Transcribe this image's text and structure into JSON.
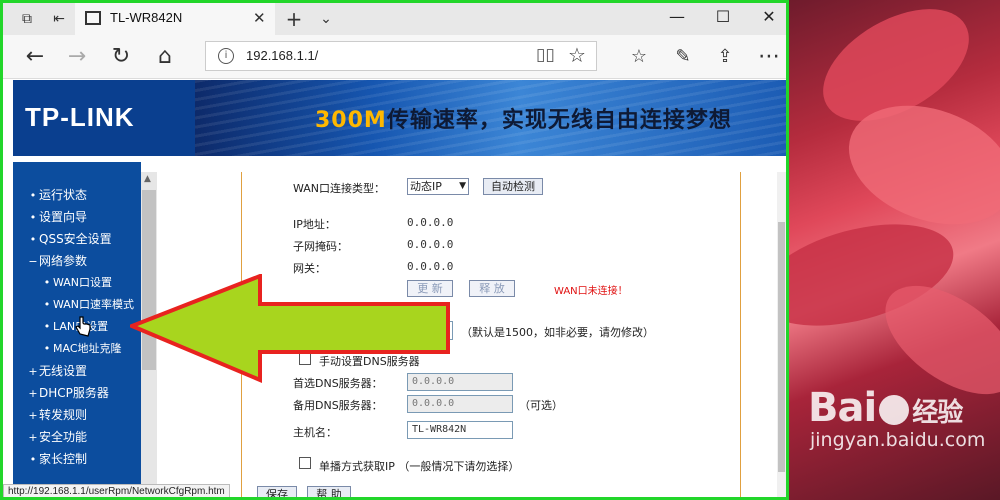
{
  "browser": {
    "tab_title": "TL-WR842N",
    "address": "192.168.1.1/",
    "status_url": "http://192.168.1.1/userRpm/NetworkCfgRpm.htm"
  },
  "banner": {
    "brand": "TP-LINK",
    "slogan_highlight": "300M",
    "slogan_rest": "传输速率，实现无线自由连接梦想"
  },
  "menu": {
    "items": [
      {
        "bullet": "•",
        "label": "运行状态"
      },
      {
        "bullet": "•",
        "label": "设置向导"
      },
      {
        "bullet": "•",
        "label": "QSS安全设置"
      },
      {
        "bullet": "−",
        "label": "网络参数"
      },
      {
        "bullet": "•",
        "label": "WAN口设置"
      },
      {
        "bullet": "•",
        "label": "WAN口速率模式"
      },
      {
        "bullet": "•",
        "label": "LAN口设置"
      },
      {
        "bullet": "•",
        "label": "MAC地址克隆"
      },
      {
        "bullet": "+",
        "label": "无线设置"
      },
      {
        "bullet": "+",
        "label": "DHCP服务器"
      },
      {
        "bullet": "+",
        "label": "转发规则"
      },
      {
        "bullet": "+",
        "label": "安全功能"
      },
      {
        "bullet": "•",
        "label": "家长控制"
      }
    ]
  },
  "form": {
    "wan_type_label": "WAN口连接类型：",
    "wan_type_value": "动态IP",
    "auto_detect": "自动检测",
    "ip_label": "IP地址：",
    "ip_value": "0.0.0.0",
    "mask_label": "子网掩码：",
    "mask_value": "0.0.0.0",
    "gateway_label": "网关：",
    "gateway_value": "0.0.0.0",
    "renew": "更 新",
    "release": "释 放",
    "wan_status": "WAN口未连接！",
    "mtu_value": "1500",
    "mtu_hint": "（默认是1500，如非必要，请勿修改）",
    "manual_dns": "手动设置DNS服务器",
    "dns1_label": "首选DNS服务器：",
    "dns1_value": "0.0.0.0",
    "dns2_label": "备用DNS服务器：",
    "dns2_value": "0.0.0.0",
    "dns2_hint": "（可选）",
    "host_label": "主机名：",
    "host_value": "TL-WR842N",
    "unicast": "单播方式获取IP （一般情况下请勿选择）",
    "save": "保存",
    "help": "帮 助"
  },
  "watermark": {
    "logo_left": "Bai",
    "logo_right": "经验",
    "url": "jingyan.baidu.com"
  },
  "colors": {
    "highlight_border": "#22d62a",
    "arrow_fill": "#a8d51e",
    "arrow_stroke": "#e8231f",
    "menu_bg": "#0c4d9e",
    "wan_status": "#e01010"
  }
}
